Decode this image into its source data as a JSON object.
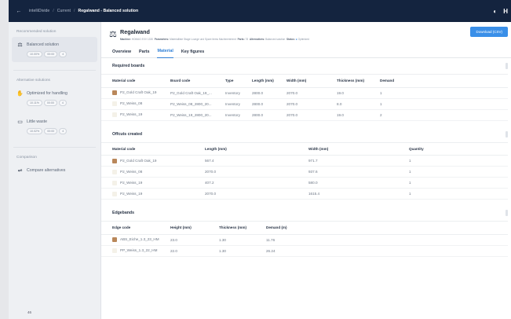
{
  "topbar": {
    "crumbs": [
      "intelliDivide",
      "Current"
    ],
    "current": "Regalwand - Balanced solution",
    "right_letter": "H"
  },
  "sidebar": {
    "recommended_heading": "Recommended solution",
    "alternative_heading": "Alternative solutions",
    "comparison_heading": "Comparison",
    "solutions": [
      {
        "label": "Balanced solution",
        "chips": [
          "10.00%",
          "00:00",
          "4"
        ]
      },
      {
        "label": "Optimized for handling",
        "chips": [
          "10.11%",
          "00:00",
          "4"
        ]
      },
      {
        "label": "Little waste",
        "chips": [
          "10.02%",
          "00:00",
          "4"
        ]
      }
    ],
    "compare_label": "Compare alternatives",
    "bottom_label": "46"
  },
  "header": {
    "title": "Regalwand",
    "meta": {
      "machine_label": "Machine:",
      "machine_value": "HOMAG EXV 1330",
      "parameters_label": "Parameters:",
      "parameters_value": "Materialliste Stage Lounge und Spare items Machinentrennt",
      "parts_label": "Parts:",
      "parts_value": "78",
      "alternatives_label": "Alternatives:",
      "alternatives_value": "Balanced solution",
      "status_label": "Status:",
      "status_value": "Optimized"
    },
    "download_label": "Download (CSV)"
  },
  "tabs": [
    "Overview",
    "Parts",
    "Material",
    "Key figures"
  ],
  "active_tab": 2,
  "required_boards": {
    "title": "Required boards",
    "columns": [
      "Material code",
      "Board code",
      "Type",
      "Length (mm)",
      "Width (mm)",
      "Thickness (mm)",
      "Demand"
    ],
    "rows": [
      {
        "swatch": "#b9875a",
        "cells": [
          "P2_Gold Craft Oak_19",
          "P2_Gold Craft Oak_19_...",
          "Inventory",
          "2800.0",
          "2070.0",
          "19.0",
          "1"
        ]
      },
      {
        "swatch": "#f4f1e8",
        "cells": [
          "P2_Weiss_08",
          "P2_Weiss_08_2800_20...",
          "Inventory",
          "2800.0",
          "2070.0",
          "8.0",
          "1"
        ]
      },
      {
        "swatch": "#f4f1e8",
        "cells": [
          "P2_Weiss_19",
          "P2_Weiss_19_2800_20...",
          "Inventory",
          "2800.0",
          "2070.0",
          "19.0",
          "2"
        ]
      }
    ]
  },
  "offcuts": {
    "title": "Offcuts created",
    "columns": [
      "Material code",
      "Length (mm)",
      "Width (mm)",
      "Quantity"
    ],
    "rows": [
      {
        "swatch": "#b9875a",
        "cells": [
          "P2_Gold Craft Oak_19",
          "567.4",
          "971.7",
          "1"
        ]
      },
      {
        "swatch": "#f4f1e8",
        "cells": [
          "P2_Weiss_08",
          "2070.0",
          "937.6",
          "1"
        ]
      },
      {
        "swatch": "#f4f1e8",
        "cells": [
          "P2_Weiss_19",
          "407.2",
          "580.0",
          "1"
        ]
      },
      {
        "swatch": "#f4f1e8",
        "cells": [
          "P2_Weiss_19",
          "2070.0",
          "1615.4",
          "1"
        ]
      }
    ]
  },
  "edgebands": {
    "title": "Edgebands",
    "columns": [
      "Edge code",
      "Height (mm)",
      "Thickness (mm)",
      "Demand (m)"
    ],
    "rows": [
      {
        "swatch": "#b9875a",
        "cells": [
          "ABS_Eiche_1.3_23_HM",
          "23.0",
          "1.30",
          "11.76"
        ]
      },
      {
        "swatch": "#f4f1e8",
        "cells": [
          "PP_Weiss_1.3_22_HM",
          "22.0",
          "1.30",
          "26.24"
        ]
      }
    ]
  }
}
